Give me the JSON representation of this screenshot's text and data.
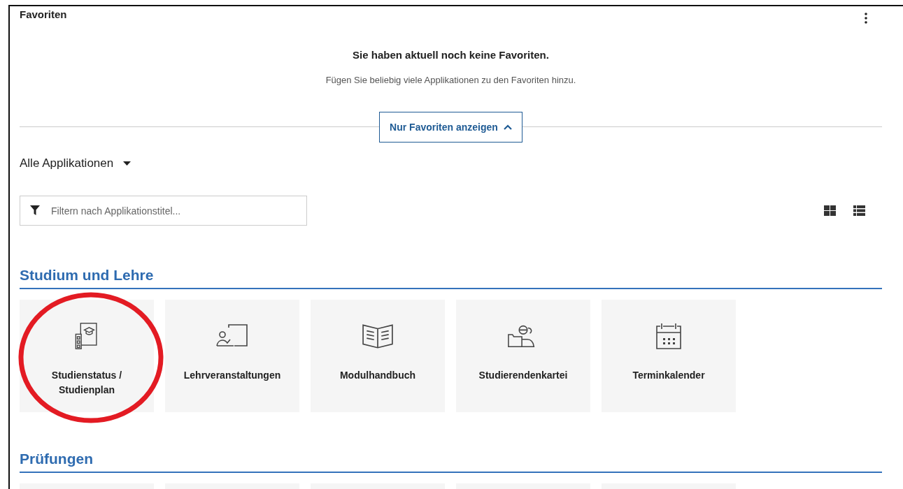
{
  "panel": {
    "title": "Favoriten"
  },
  "empty_state": {
    "heading": "Sie haben aktuell noch keine Favoriten.",
    "hint": "Fügen Sie beliebig viele Applikationen zu den Favoriten hinzu."
  },
  "toggle_button": {
    "label": "Nur Favoriten anzeigen",
    "expanded": true
  },
  "dropdown": {
    "label": "Alle Applikationen"
  },
  "filter": {
    "placeholder": "Filtern nach Applikationstitel..."
  },
  "sections": [
    {
      "title": "Studium und Lehre",
      "tiles": [
        {
          "label": "Studienstatus / Studienplan",
          "kind": "status",
          "highlighted": true
        },
        {
          "label": "Lehrveranstaltungen",
          "kind": "teaching",
          "highlighted": false
        },
        {
          "label": "Modulhandbuch",
          "kind": "book",
          "highlighted": false
        },
        {
          "label": "Studierendenkartei",
          "kind": "students",
          "highlighted": false
        },
        {
          "label": "Terminkalender",
          "kind": "calendar",
          "highlighted": false
        }
      ]
    },
    {
      "title": "Prüfungen",
      "tiles": [
        {
          "kind": "blank"
        },
        {
          "kind": "blank"
        },
        {
          "kind": "blank"
        },
        {
          "kind": "blank"
        },
        {
          "kind": "blank"
        }
      ]
    }
  ]
}
